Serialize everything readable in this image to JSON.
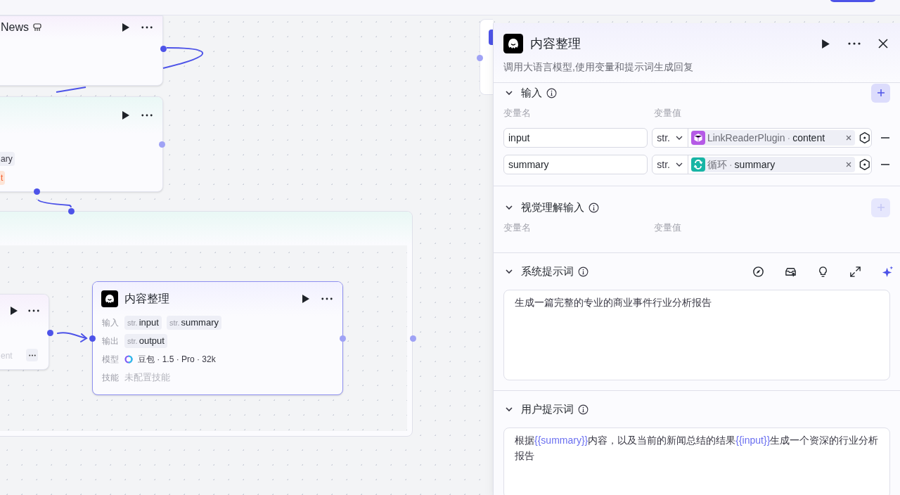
{
  "canvas": {
    "nodes": [
      {
        "kind": "plugin",
        "title": "News"
      },
      {
        "kind": "plain",
        "tags": [
          {
            "text": "ary",
            "kind": "neutral"
          },
          {
            "text": "t",
            "kind": "warning"
          }
        ]
      },
      {
        "kind": "loop"
      },
      {
        "kind": "small",
        "faded": "ent"
      },
      {
        "kind": "llm",
        "title": "内容整理",
        "rows": [
          {
            "label": "输入",
            "vars": [
              {
                "type": "str.",
                "name": "input"
              },
              {
                "type": "str.",
                "name": "summary"
              }
            ]
          },
          {
            "label": "输出",
            "vars": [
              {
                "type": "str.",
                "name": "output"
              }
            ]
          },
          {
            "label": "模型",
            "model": "豆包 · 1.5 · Pro · 32k"
          },
          {
            "label": "技能",
            "empty": "未配置技能"
          }
        ]
      },
      {
        "kind": "hidden"
      }
    ]
  },
  "panel": {
    "title": "内容整理",
    "description": "调用大语言模型,使用变量和提示词生成回复",
    "sections": [
      {
        "kind": "vars",
        "title": "输入",
        "expanded": true,
        "add_disabled": false,
        "columns": [
          "变量名",
          "变量值"
        ],
        "rows": [
          {
            "name": "input",
            "type": "str.",
            "kind": "plugin",
            "source": "LinkReaderPlugin",
            "separator": "·",
            "field": "content"
          },
          {
            "name": "summary",
            "type": "str.",
            "kind": "loop",
            "source": "循环",
            "separator": "·",
            "field": "summary"
          }
        ]
      },
      {
        "kind": "vars",
        "title": "视觉理解输入",
        "expanded": true,
        "add_disabled": true,
        "columns": [
          "变量名",
          "变量值"
        ]
      },
      {
        "kind": "prompt",
        "title": "系统提示词",
        "expanded": true,
        "tools": true,
        "segments": [
          {
            "text": "生成一篇完整的专业的商业事件行业分析报告",
            "variable": false
          }
        ]
      },
      {
        "kind": "prompt",
        "title": "用户提示词",
        "expanded": true,
        "tools": false,
        "segments": [
          {
            "text": "根据",
            "variable": false
          },
          {
            "text": "{{summary}}",
            "variable": true
          },
          {
            "text": "内容，以及当前的新闻总结的结果",
            "variable": false
          },
          {
            "text": "{{input}}",
            "variable": true
          },
          {
            "text": "生成一个资深的行业分析报告",
            "variable": false
          }
        ]
      }
    ]
  }
}
